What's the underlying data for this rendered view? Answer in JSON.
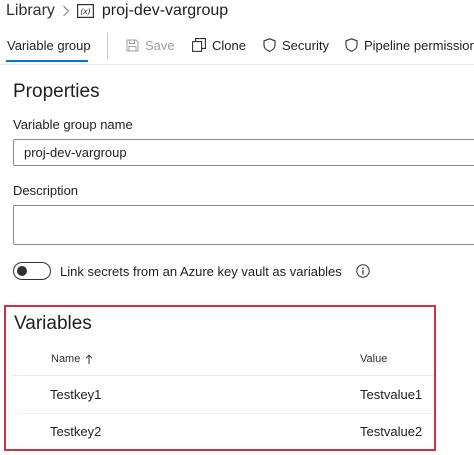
{
  "breadcrumb": {
    "library": "Library",
    "current": "proj-dev-vargroup"
  },
  "toolbar": {
    "active_tab": "Variable group",
    "save": "Save",
    "clone": "Clone",
    "security": "Security",
    "pipeline_permissions": "Pipeline permissions"
  },
  "properties": {
    "title": "Properties",
    "name_label": "Variable group name",
    "name_value": "proj-dev-vargroup",
    "description_label": "Description",
    "description_value": "",
    "link_secrets_label": "Link secrets from an Azure key vault as variables",
    "link_secrets_enabled": false
  },
  "variables": {
    "title": "Variables",
    "columns": {
      "name": "Name",
      "value": "Value"
    },
    "rows": [
      {
        "name": "Testkey1",
        "value": "Testvalue1"
      },
      {
        "name": "Testkey2",
        "value": "Testvalue2"
      }
    ]
  },
  "colors": {
    "accent": "#0078d4",
    "highlight_border": "#d0303f",
    "disabled_text": "#a19f9d"
  },
  "icons": {
    "separator": "chevron-right-icon",
    "variable_group": "variable-group-icon",
    "save": "save-icon",
    "clone": "clone-icon",
    "security": "shield-icon",
    "pipeline": "shield-icon",
    "sort": "arrow-up-icon",
    "info": "info-icon"
  }
}
